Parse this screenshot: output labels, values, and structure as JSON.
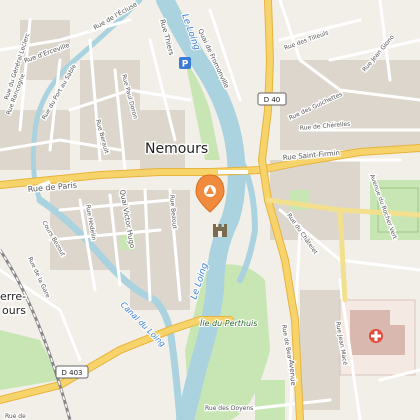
{
  "city_name": "Nemours",
  "city_name_partial": "erre-",
  "city_name_partial_2": "ours",
  "river_name": "Le Loing",
  "canal_name": "Canal du Loing",
  "island_name": "Île du Perthuis",
  "road_shields": {
    "d40": "D 40",
    "d403": "D 403"
  },
  "streets": {
    "rue_de_paris": "Rue de Paris",
    "rue_saint_firmin": "Rue Saint-Firmin",
    "rue_thiers": "Rue Thiers",
    "quai_fromonville": "Quai de Fromonville",
    "quai_victor_hugo": "Quai Victor Hugo",
    "rue_de_lecluse": "Rue de l'Écluse",
    "rue_dercevillle": "Rue d'Erceville",
    "rue_du_general_leclerc": "Rue du Général Leclerc",
    "rue_rancogne": "Rue Rancogne",
    "rue_du_port_au_sable": "Rue du Port au Sable",
    "rue_paul_doron": "Rue Paul Doron",
    "rue_berault": "Rue Berault",
    "rue_de_bezout": "Rue Bezout",
    "cours_bezout": "Cours Bezout",
    "rue_hedelin": "Rue Hédelin",
    "rue_de_la_gare": "Rue de la Gare",
    "rue_des_tilleuls": "Rue des Tilleuls",
    "rue_jean_giono": "Rue Jean Giono",
    "rue_des_guichettes": "Rue des Guichettes",
    "rue_de_cherelles": "Rue de Chérelles",
    "avenue_du_rocher_vert": "Avenue du Rocher Vert",
    "rue_du_chatelet": "Rue du Châtelet",
    "rue_de_beauregard": "Rue de Beauregard",
    "rue_jean_mace": "Rue Jean Macé",
    "avenue": "Avenue",
    "rue_des_doyens": "Rue des Doyens",
    "rue_de": "Rue de"
  },
  "pois": {
    "parking": "P",
    "marker": "tourist-office-marker",
    "castle": "castle-icon",
    "hospital": "hospital-icon"
  },
  "colors": {
    "background": "#f2efe9",
    "water": "#aad3df",
    "park": "#c8e6b3",
    "major_road": "#f7d46b",
    "marker": "#f08a3c",
    "hospital": "#e24b3f"
  }
}
